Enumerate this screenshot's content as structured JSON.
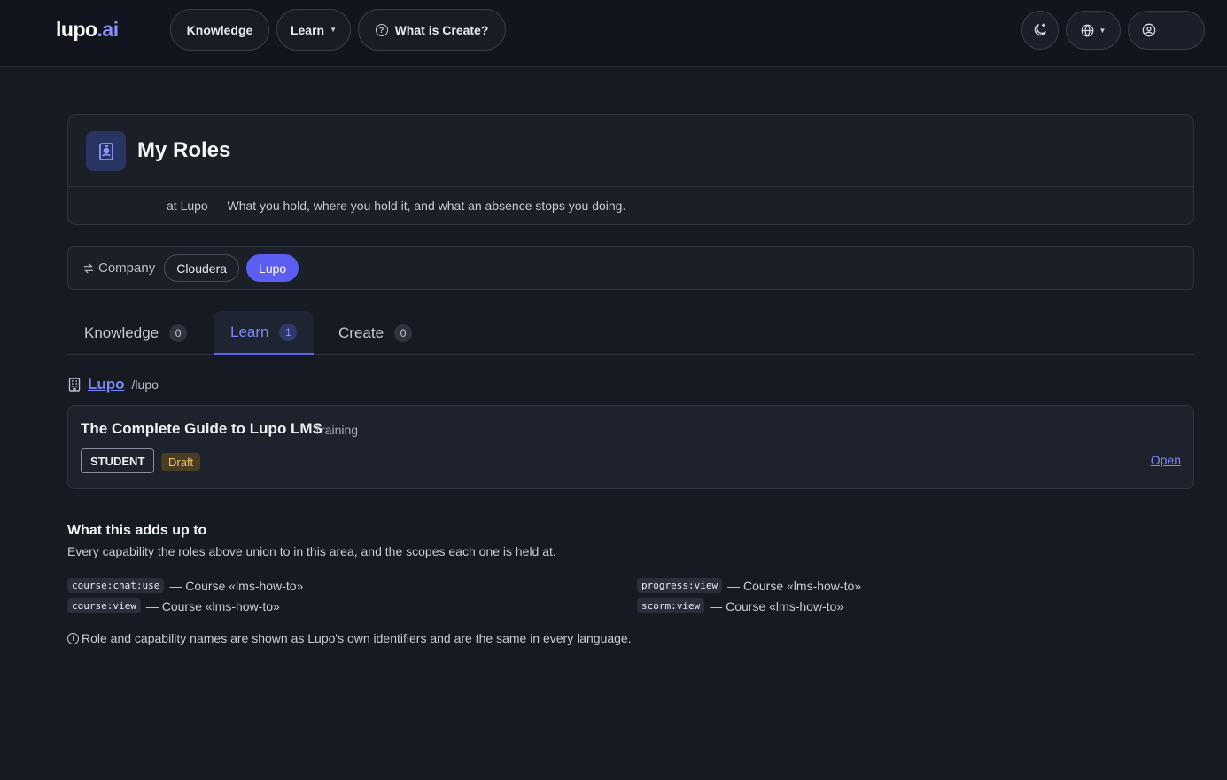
{
  "nav": {
    "logo_main": "lupo",
    "logo_suffix": ".ai",
    "knowledge": "Knowledge",
    "learn": "Learn",
    "what_is_create": "What is Create?"
  },
  "header": {
    "title": "My Roles",
    "subtitle": "at Lupo — What you hold, where you hold it, and what an absence stops you doing."
  },
  "company": {
    "label": "Company",
    "options": [
      "Cloudera",
      "Lupo"
    ],
    "selected": "Lupo"
  },
  "tabs": [
    {
      "label": "Knowledge",
      "count": "0"
    },
    {
      "label": "Learn",
      "count": "1"
    },
    {
      "label": "Create",
      "count": "0"
    }
  ],
  "active_tab": "Learn",
  "org": {
    "name": "Lupo",
    "path": "/lupo"
  },
  "course": {
    "title": "The Complete Guide to Lupo LMS",
    "type": "Training",
    "role": "STUDENT",
    "status": "Draft",
    "open": "Open"
  },
  "summary": {
    "title": "What this adds up to",
    "description": "Every capability the roles above union to in this area, and the scopes each one is held at."
  },
  "capabilities": [
    {
      "name": "course:chat:use",
      "scope": "— Course «lms-how-to»"
    },
    {
      "name": "course:view",
      "scope": "— Course «lms-how-to»"
    },
    {
      "name": "progress:view",
      "scope": "— Course «lms-how-to»"
    },
    {
      "name": "scorm:view",
      "scope": "— Course «lms-how-to»"
    }
  ],
  "note": "Role and capability names are shown as Lupo's own identifiers and are the same in every language.",
  "colors": {
    "accent": "#5b5ef0",
    "link": "#7d86f5",
    "background": "#161a23"
  }
}
